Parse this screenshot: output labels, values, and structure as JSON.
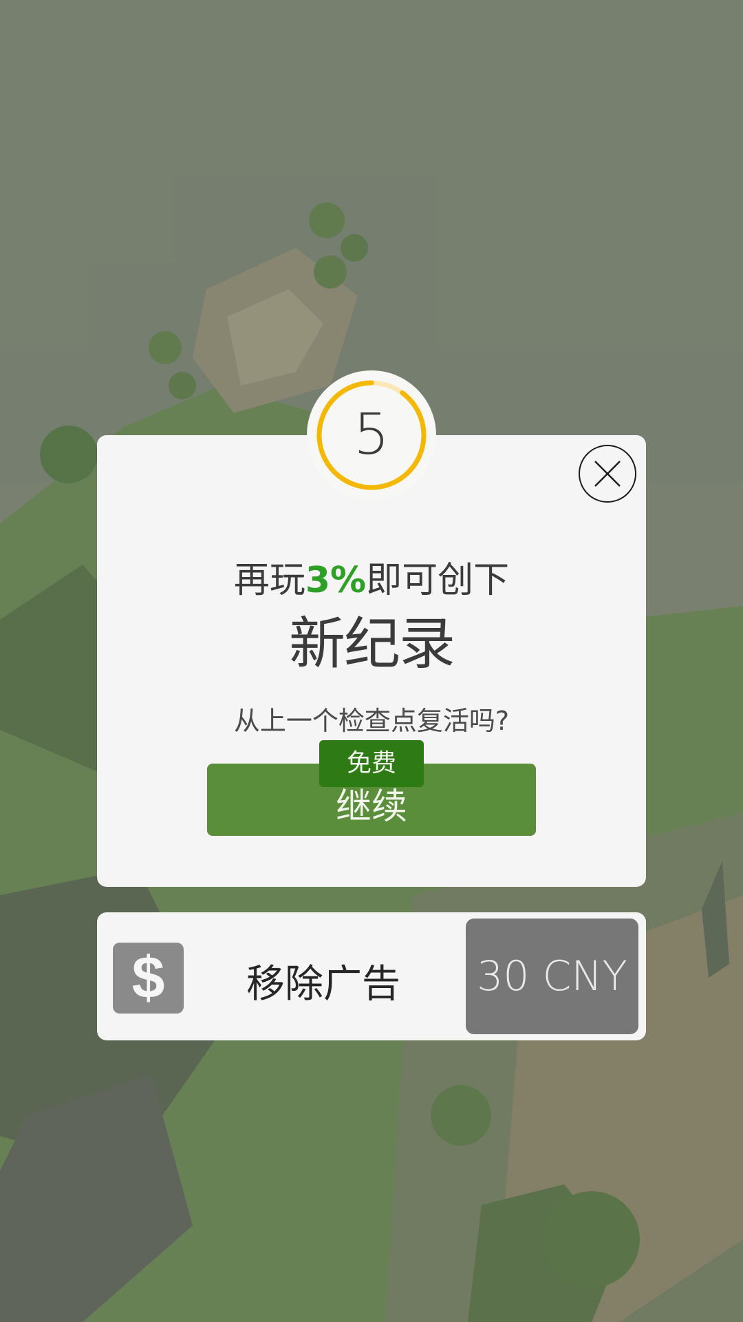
{
  "countdown": {
    "seconds": "5",
    "ring_color": "#f5b800",
    "ring_track_color": "#fbe7b5",
    "progress": 0.9
  },
  "dialog": {
    "headline_prefix": "再玩",
    "headline_percent": "3%",
    "headline_suffix": "即可创下",
    "headline_big": "新纪录",
    "question": "从上一个检查点复活吗?",
    "free_badge": "免费",
    "continue_label": "继续",
    "close_icon": "close-icon"
  },
  "remove_ads": {
    "icon": "dollar-icon",
    "icon_glyph": "$",
    "label": "移除广告",
    "price": "30 CNY"
  },
  "colors": {
    "accent_green": "#5a8e3b",
    "badge_green": "#2e7a14",
    "percent_green": "#2ea025",
    "price_button_gray": "#777777"
  }
}
